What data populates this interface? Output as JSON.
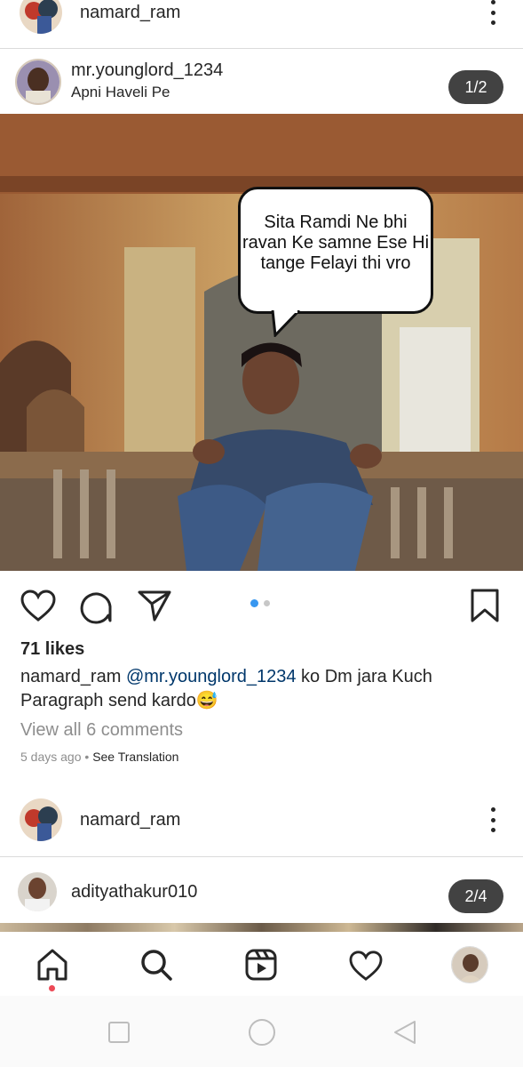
{
  "top_post_header": {
    "username": "namard_ram"
  },
  "post": {
    "username": "mr.younglord_1234",
    "location": "Apni Haveli Pe",
    "carousel_counter": "1/2",
    "image_text": "Sita Ramdi Ne bhi ravan Ke samne Ese Hi tange Felayi thi vro",
    "likes": "71 likes",
    "caption_user": "namard_ram",
    "caption_mention": "@mr.younglord_1234",
    "caption_text": " ko Dm jara Kuch Paragraph send kardo😅",
    "view_comments": "View all 6 comments",
    "timestamp": "5 days ago",
    "see_translation": "See Translation",
    "carousel_dots": {
      "count": 2,
      "active": 0,
      "active_color": "#3897f0",
      "inactive_color": "#c7c7c7"
    }
  },
  "next_post_header": {
    "username": "namard_ram"
  },
  "next_post": {
    "username": "adityathakur010",
    "carousel_counter": "2/4"
  },
  "bottom_nav": {
    "items": [
      {
        "icon": "home-icon",
        "active": true
      },
      {
        "icon": "search-icon"
      },
      {
        "icon": "reels-icon"
      },
      {
        "icon": "heart-icon"
      },
      {
        "icon": "profile-avatar"
      }
    ],
    "notification_dot_color": "#ed4956"
  },
  "system_nav": {
    "items": [
      "recents-square-icon",
      "home-circle-icon",
      "back-triangle-icon"
    ]
  }
}
